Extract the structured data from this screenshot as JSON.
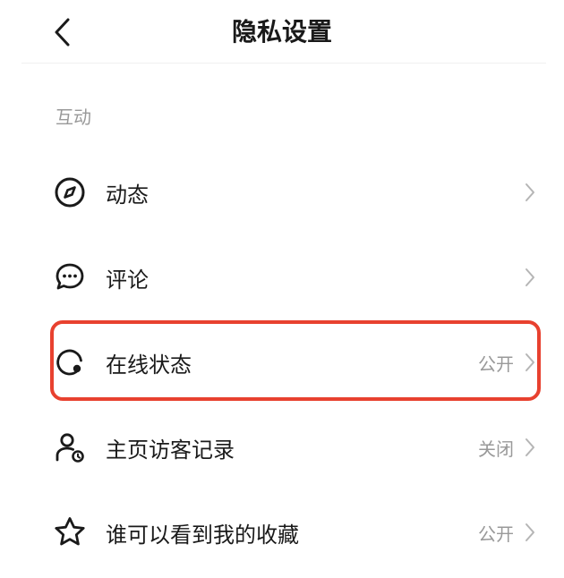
{
  "header": {
    "title": "隐私设置",
    "back_icon": "chevron-left-icon"
  },
  "section": {
    "title": "互动"
  },
  "rows": [
    {
      "label": "动态",
      "value": "",
      "icon": "compass-icon"
    },
    {
      "label": "评论",
      "value": "",
      "icon": "chat-bubble-icon"
    },
    {
      "label": "在线状态",
      "value": "公开",
      "icon": "online-status-icon"
    },
    {
      "label": "主页访客记录",
      "value": "关闭",
      "icon": "visitor-icon"
    },
    {
      "label": "谁可以看到我的收藏",
      "value": "公开",
      "icon": "star-icon"
    }
  ],
  "colors": {
    "highlight": "#e8412f",
    "secondary_text": "#999999",
    "primary_text": "#1a1a1a"
  }
}
